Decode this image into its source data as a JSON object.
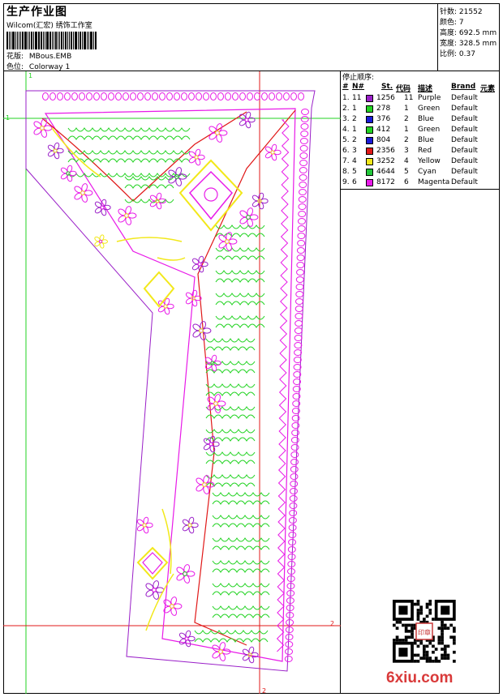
{
  "header": {
    "title": "生产作业图",
    "subtitle": "Wilcom(汇宏) 绣饰工作室",
    "design_label": "花版:",
    "design_value": "MBous.EMB",
    "colorway_label": "色位:",
    "colorway_value": "Colorway 1"
  },
  "stats": [
    {
      "label": "针数:",
      "value": "21552"
    },
    {
      "label": "颜色:",
      "value": "7"
    },
    {
      "label": "高度:",
      "value": "692.5 mm"
    },
    {
      "label": "宽度:",
      "value": "328.5 mm"
    },
    {
      "label": "比例:",
      "value": "0.37"
    }
  ],
  "stops": {
    "title": "停止顺序:",
    "headers": {
      "num": "#",
      "n": "N#",
      "st": "St.",
      "code": "代码",
      "desc": "描述",
      "brand": "Brand",
      "element": "元素"
    },
    "rows": [
      {
        "num": "1.",
        "n": "11",
        "color": "#9a1fc8",
        "st": "1256",
        "code": "11",
        "desc": "Purple",
        "brand": "Default"
      },
      {
        "num": "2.",
        "n": "1",
        "color": "#22d322",
        "st": "278",
        "code": "1",
        "desc": "Green",
        "brand": "Default"
      },
      {
        "num": "3.",
        "n": "2",
        "color": "#1a1ad6",
        "st": "376",
        "code": "2",
        "desc": "Blue",
        "brand": "Default"
      },
      {
        "num": "4.",
        "n": "1",
        "color": "#22d322",
        "st": "412",
        "code": "1",
        "desc": "Green",
        "brand": "Default"
      },
      {
        "num": "5.",
        "n": "2",
        "color": "#1a1ad6",
        "st": "804",
        "code": "2",
        "desc": "Blue",
        "brand": "Default"
      },
      {
        "num": "6.",
        "n": "3",
        "color": "#e01818",
        "st": "2356",
        "code": "3",
        "desc": "Red",
        "brand": "Default"
      },
      {
        "num": "7.",
        "n": "4",
        "color": "#f2e81a",
        "st": "3252",
        "code": "4",
        "desc": "Yellow",
        "brand": "Default"
      },
      {
        "num": "8.",
        "n": "5",
        "color": "#22c83a",
        "st": "4644",
        "code": "5",
        "desc": "Cyan",
        "brand": "Default"
      },
      {
        "num": "9.",
        "n": "6",
        "color": "#e81ae8",
        "st": "8172",
        "code": "6",
        "desc": "Magenta",
        "brand": "Default"
      }
    ]
  },
  "canvas": {
    "guide_labels": {
      "top_left": "1",
      "left_mid": "1",
      "right_mid": "2",
      "bottom": "2"
    },
    "colors": {
      "outline": "#9a1fc8",
      "green": "#22d322",
      "magenta": "#e81ae8",
      "yellow": "#f2e81a",
      "red": "#e01818",
      "blue": "#1a1ad6"
    }
  },
  "watermark": {
    "text": "6xiu",
    "suffix": ".com"
  },
  "qr": {
    "stamp_text": "印章"
  }
}
